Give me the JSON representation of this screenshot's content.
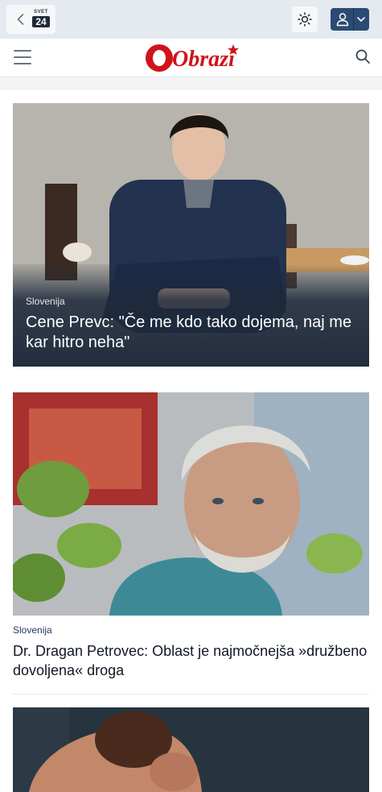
{
  "topbar": {
    "back_icon": "chevron-left-icon",
    "brand": {
      "top": "SVET",
      "bottom": "24"
    },
    "theme_icon": "sun-icon",
    "user_icon": "user-icon",
    "user_menu_icon": "chevron-down-icon"
  },
  "header": {
    "menu_icon": "hamburger-icon",
    "logo_text": "Obrazi",
    "search_icon": "search-icon"
  },
  "articles": [
    {
      "category": "Slovenija",
      "title": "Cene Prevc: \"Če me kdo tako dojema, naj me kar hitro neha\""
    },
    {
      "category": "Slovenija",
      "title": "Dr. Dragan Petrovec: Oblast je najmočnejša »družbeno dovoljena« droga"
    },
    {
      "category": "",
      "title": ""
    }
  ],
  "colors": {
    "topbar_bg": "#e5e9f0",
    "accent": "#2c4b73",
    "logo_red": "#d0121b",
    "card_overlay": "#1e293b"
  }
}
